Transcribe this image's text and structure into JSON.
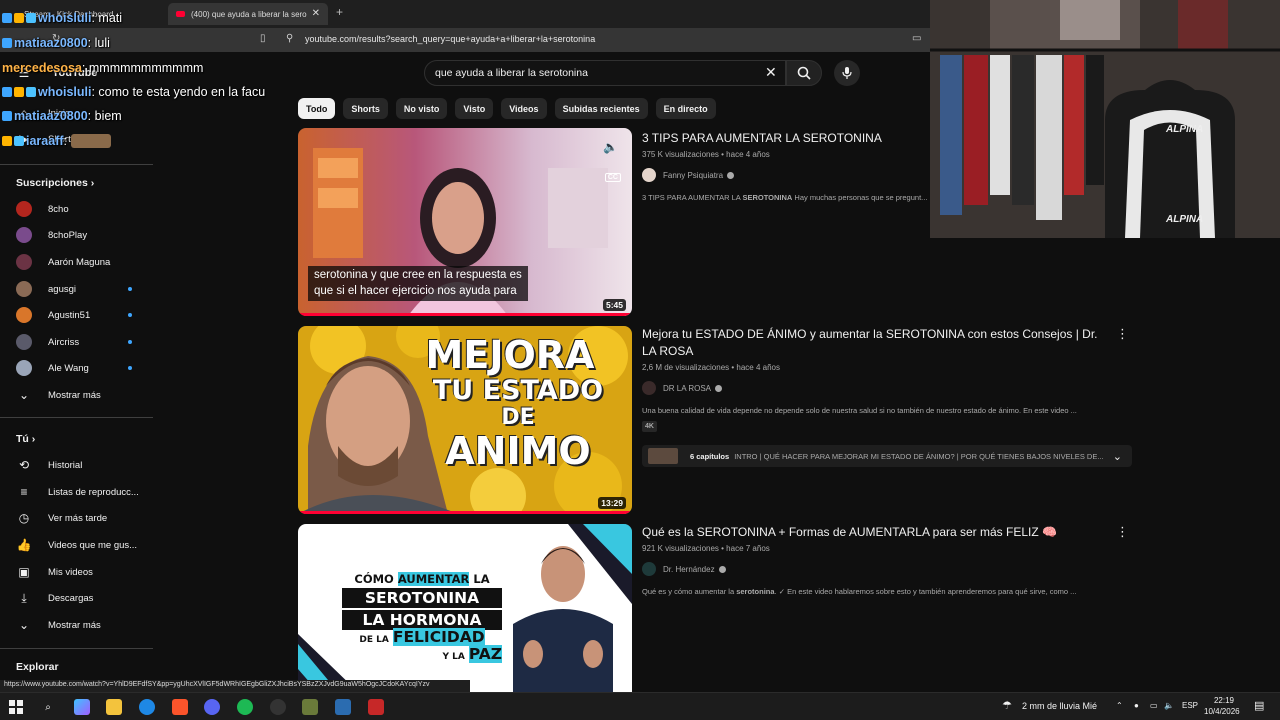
{
  "browser": {
    "tabs": [
      {
        "label": "Stream - Kick Dashboard"
      },
      {
        "label": "(400) que ayuda a liberar la sero"
      }
    ],
    "url": "youtube.com/results?search_query=que+ayuda+a+liberar+la+serotonina",
    "status_url": "https://www.youtube.com/watch?v=YhlD9EFdfSY&pp=ygUhcXVlIGF5dWRhIGEgbGliZXJhciBsYSBzZXJvdG9uaW5hOgcJCdoKAYcqIYzv"
  },
  "youtube": {
    "logo": "YouTube",
    "search_query": "que ayuda a liberar la serotonina",
    "filters": [
      "Todo",
      "Shorts",
      "No visto",
      "Visto",
      "Videos",
      "Subidas recientes",
      "En directo"
    ],
    "active_filter": "Todo"
  },
  "sidebar": {
    "top": [
      {
        "label": "Inicio",
        "icon": "home-icon"
      },
      {
        "label": "Shorts",
        "icon": "shorts-icon"
      }
    ],
    "subscriptions_heading": "Suscripciones",
    "subscriptions": [
      {
        "label": "8cho",
        "color": "#b3261e",
        "live": false
      },
      {
        "label": "8choPlay",
        "color": "#7a4b8c",
        "live": false
      },
      {
        "label": "Aarón Maguna",
        "color": "#6b3344",
        "live": false
      },
      {
        "label": "agusgi",
        "color": "#8a6a55",
        "live": true
      },
      {
        "label": "Agustin51",
        "color": "#d9762a",
        "live": true
      },
      {
        "label": "Aircriss",
        "color": "#5a5a6a",
        "live": true
      },
      {
        "label": "Ale Wang",
        "color": "#9aa5b8",
        "live": true
      }
    ],
    "show_more_subs": "Mostrar más",
    "you_heading": "Tú",
    "you_items": [
      {
        "label": "Historial",
        "icon": "history-icon"
      },
      {
        "label": "Listas de reproducc...",
        "icon": "playlists-icon"
      },
      {
        "label": "Ver más tarde",
        "icon": "watch-later-icon"
      },
      {
        "label": "Videos que me gus...",
        "icon": "like-icon"
      },
      {
        "label": "Mis videos",
        "icon": "my-videos-icon"
      },
      {
        "label": "Descargas",
        "icon": "download-icon"
      },
      {
        "label": "Mostrar más",
        "icon": "chevron-down-icon"
      }
    ],
    "explore_heading": "Explorar"
  },
  "chat": [
    {
      "user": "whoisluli",
      "message": ": mati",
      "color": "#7ab8ff"
    },
    {
      "user": "matiaaz0800",
      "message": ": luli",
      "color": "#7ab8ff"
    },
    {
      "user": "mercedesosa",
      "message": ": mmmmmmmmmmm",
      "color": "#ffb347"
    },
    {
      "user": "whoisluli",
      "message": ": como te esta yendo en la facu",
      "color": "#7ab8ff"
    },
    {
      "user": "matiaaz0800",
      "message": ": biem",
      "color": "#7ab8ff"
    },
    {
      "user": "iaraaff",
      "message": ":",
      "color": "#7ab8ff"
    }
  ],
  "results": [
    {
      "title": "3 TIPS PARA AUMENTAR LA SEROTONINA",
      "meta": "375 K visualizaciones • hace 4 años",
      "channel": "Fanny Psiquiatra",
      "desc_pre": "3 TIPS PARA AUMENTAR LA ",
      "desc_bold": "SEROTONINA",
      "desc_post": " Hay muchas personas que se pregunt...",
      "duration": "5:45",
      "caption_line1": "serotonina y que cree en la respuesta es",
      "caption_line2": "que si el hacer ejercicio nos ayuda para",
      "cc_label": "CC"
    },
    {
      "title": "Mejora tu ESTADO DE ÁNIMO y aumentar la SEROTONINA con estos Consejos | Dr. LA ROSA",
      "meta": "2,6 M de visualizaciones • hace 4 años",
      "channel": "DR LA ROSA",
      "desc": "Una buena calidad de vida depende no depende solo de nuestra salud si no también de nuestro estado de ánimo. En este video ...",
      "badge": "4K",
      "chapters_count": "6 capítulos",
      "chapters_text": "INTRO | QUÉ HACER PARA MEJORAR MI ESTADO DE ÁNIMO? | POR QUÉ TIENES BAJOS NIVELES DE...",
      "duration": "13:29",
      "thumb_lines": [
        "MEJORA",
        "TU ESTADO",
        "DE",
        "ANIMO"
      ]
    },
    {
      "title": "Qué es la SEROTONINA + Formas de AUMENTARLA para ser más FELIZ 🧠",
      "meta": "921 K visualizaciones • hace 7 años",
      "channel": "Dr. Hernández",
      "desc_pre": "Qué es y cómo aumentar la ",
      "desc_bold": "serotonina",
      "desc_post": ". ✓ En este video hablaremos sobre esto y también aprenderemos para qué sirve, como ...",
      "thumb_lines": [
        "CÓMO",
        "AUMENTAR",
        "LA",
        "SEROTONINA",
        "LA HORMONA",
        "DE LA",
        "FELICIDAD",
        "Y LA",
        "PAZ"
      ]
    }
  ],
  "webcam": {
    "chair_brand": "ALPINA"
  },
  "taskbar": {
    "weather": "2 mm de lluvia Mié",
    "language": "ESP",
    "time": "22:19",
    "date": "10/4/2026"
  }
}
